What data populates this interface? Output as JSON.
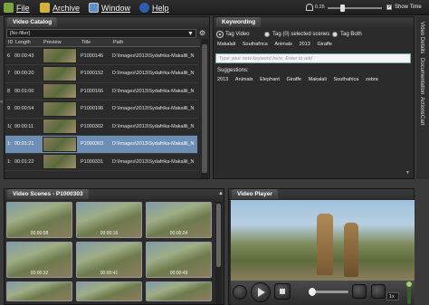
{
  "menu": {
    "file": "File",
    "archive": "Archive",
    "window": "Window",
    "help": "Help",
    "volume_value": "0.25",
    "show_time": "Show Time"
  },
  "catalog": {
    "title": "Video Catalog",
    "filter": "[No filter]",
    "columns": [
      "ID",
      "Length",
      "Preview",
      "Title",
      "Path"
    ],
    "rows": [
      {
        "id": "6",
        "length": "00:00:43",
        "title": "P1000146",
        "path": "D:\\Images\\2013\\Sydafrika-Makalili_N"
      },
      {
        "id": "7",
        "length": "00:00:20",
        "title": "P1000152",
        "path": "D:\\Images\\2013\\Sydafrika-Makalili_N"
      },
      {
        "id": "8",
        "length": "00:01:00",
        "title": "P1000166",
        "path": "D:\\Images\\2013\\Sydafrika-Makalili_N"
      },
      {
        "id": "9",
        "length": "00:00:54",
        "title": "P1000196",
        "path": "D:\\Images\\2013\\Sydafrika-Makalili_N"
      },
      {
        "id": "1(",
        "length": "00:00:11",
        "title": "P1000302",
        "path": "D:\\Images\\2013\\Sydafrika-Makalili_N"
      },
      {
        "id": "1:",
        "length": "00:01:21",
        "title": "P1000303",
        "path": "D:\\Images\\2013\\Sydafrika-Makalili_N"
      },
      {
        "id": "1:",
        "length": "00:01:22",
        "title": "P1000331",
        "path": "D:\\Images\\2013\\Sydafrika-Makalili_N"
      }
    ]
  },
  "keywording": {
    "title": "Keywording",
    "tag_video": "Tag Video",
    "tag_selected": "Tag (0) selected scenes",
    "tag_both": "Tag Both",
    "tags": [
      "Makalali",
      "Southafrica",
      "Animals",
      "2013",
      "Giraffe"
    ],
    "input_placeholder": "Type your new keyword here. Enter to add",
    "suggestions_label": "Suggestions:",
    "suggestions": [
      "2013",
      "Animals",
      "Elephant",
      "Giraffe",
      "Makalali",
      "Southafrica",
      "zebra"
    ]
  },
  "scenes": {
    "title": "Video Scenes - P1000303",
    "items": [
      "00:00:08",
      "00:00:16",
      "00:00:24",
      "00:00:32",
      "00:00:41",
      "00:00:49",
      "",
      "",
      ""
    ]
  },
  "player": {
    "title": "Video Player",
    "speed": "1x"
  },
  "side_tabs": [
    "Video Details",
    "Documentation",
    "Actions",
    "Cart"
  ]
}
